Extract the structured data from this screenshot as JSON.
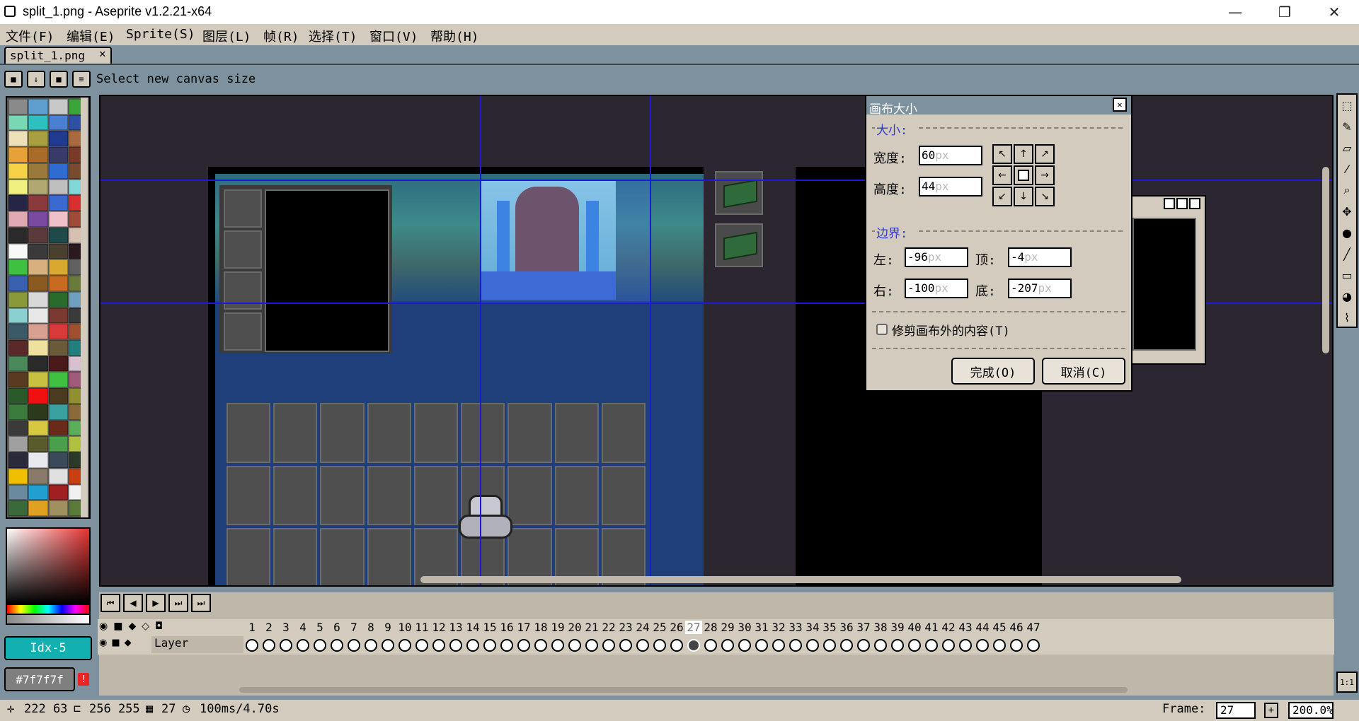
{
  "window": {
    "title": "split_1.png - Aseprite v1.2.21-x64",
    "minimize": "—",
    "restore": "❐",
    "close": "✕"
  },
  "menu": [
    "文件(F)",
    "编辑(E)",
    "Sprite(S)",
    "图层(L)",
    "帧(R)",
    "选择(T)",
    "窗口(V)",
    "帮助(H)"
  ],
  "tab": {
    "label": "split_1.png",
    "close": "✕"
  },
  "context_bar": {
    "message": "Select new canvas size",
    "buttons": [
      "lock-icon",
      "down-arrow-icon",
      "stop-icon",
      "menu-icon"
    ]
  },
  "colors": {
    "accent": "#12b0b0",
    "guide_line": "#1b1bd6",
    "dialog_bg": "#d3cbbe",
    "desktop": "#7d929e",
    "canvas_bg": "#2b2630"
  },
  "palette": [
    "#8a8a8a",
    "#5e9fcf",
    "#c8c8c8",
    "#3aa63a",
    "#7ad7b4",
    "#2ec0c0",
    "#4a7fd1",
    "#2f4fa5",
    "#eee0b9",
    "#a8a040",
    "#1f3a8f",
    "#a86b40",
    "#e8a038",
    "#a86b28",
    "#3a3a6a",
    "#7a3a2a",
    "#f5d148",
    "#9a7a3a",
    "#2f6bd0",
    "#7a4a30",
    "#f0f080",
    "#b0a870",
    "#bfbfbf",
    "#80d8d8",
    "#252545",
    "#8a3a3a",
    "#3a6ad0",
    "#d83030",
    "#e0a8b0",
    "#7a4aa0",
    "#f0c0c8",
    "#a04a3a",
    "#2a2a2a",
    "#5a3a3a",
    "#204a4a",
    "#d8c0b0",
    "#f8f8f8",
    "#3a3a3a",
    "#4a4030",
    "#2a1a20",
    "#40c040",
    "#d8b080",
    "#d8a830",
    "#606060",
    "#3a60b0",
    "#8a5a20",
    "#c86a20",
    "#6a7a3a",
    "#8a9a3a",
    "#d8d8d8",
    "#2a6a2a",
    "#70a0c0",
    "#8ad0d0",
    "#e8e8e8",
    "#7a3a30",
    "#3a3a3a",
    "#3a5a6a",
    "#d8a090",
    "#d83a3a",
    "#a05030",
    "#5a2a2a",
    "#f0e0a0",
    "#6a5a3a",
    "#208080",
    "#4a8a5a",
    "#2a2a2a",
    "#4a1a1a",
    "#d8c0d0",
    "#5a3a20",
    "#c8c040",
    "#40c040",
    "#a05a7a",
    "#2a5a2a",
    "#f01010",
    "#4a3a20",
    "#909030",
    "#3a7a3a",
    "#2a3a1a",
    "#3aa0a0",
    "#8a6a3a",
    "#3a3a3a",
    "#d8c840",
    "#6a2a1a",
    "#5ab05a",
    "#a0a0a0",
    "#5a5a2a",
    "#4aa04a",
    "#b0c040",
    "#2a2a3a",
    "#e8e8f0",
    "#3a4a5a",
    "#2a3a2a",
    "#f0c000",
    "#8a7a6a",
    "#e0e0e0",
    "#c84010",
    "#6a8aa0",
    "#20a0d0",
    "#a02020",
    "#f0f0f0",
    "#3a6a3a",
    "#e0a020",
    "#a09060",
    "#5a7a3a"
  ],
  "color_bar": {
    "fg_label": "Idx-5",
    "bg_label": "#7f7f7f",
    "warning": "!"
  },
  "dialog": {
    "title": "画布大小",
    "close": "✕",
    "size_group": "大小:",
    "width_label": "宽度:",
    "width_value": "60",
    "height_label": "高度:",
    "height_value": "44",
    "unit": "px",
    "border_group": "边界:",
    "left_label": "左:",
    "left_value": "-96",
    "top_label": "顶:",
    "top_value": "-4",
    "right_label": "右:",
    "right_value": "-100",
    "bottom_label": "底:",
    "bottom_value": "-207",
    "trim_label": "修剪画布外的内容(T)",
    "trim_checked": false,
    "ok": "完成(O)",
    "cancel": "取消(C)",
    "anchor_arrows": [
      "↖",
      "↑",
      "↗",
      "←",
      "",
      "→",
      "↙",
      "↓",
      "↘"
    ]
  },
  "tools": [
    "rect-marquee-icon",
    "pencil-icon",
    "eraser-icon",
    "eyedropper-icon",
    "zoom-icon",
    "move-icon",
    "paint-bucket-icon",
    "line-icon",
    "rectangle-icon",
    "contour-icon",
    "blur-icon"
  ],
  "timeline": {
    "buttons": [
      "⏮",
      "◀",
      "▶",
      "⏭",
      "⏭"
    ],
    "layer_name": "Layer",
    "frame_count": 47,
    "current_frame": 27,
    "one_to_one": "1:1"
  },
  "status": {
    "cursor": "222 63",
    "size": "256 255",
    "frame": "27",
    "duration": "100ms/4.70s",
    "frame_label": "Frame:",
    "frame_value": "27",
    "zoom": "200.0%"
  }
}
